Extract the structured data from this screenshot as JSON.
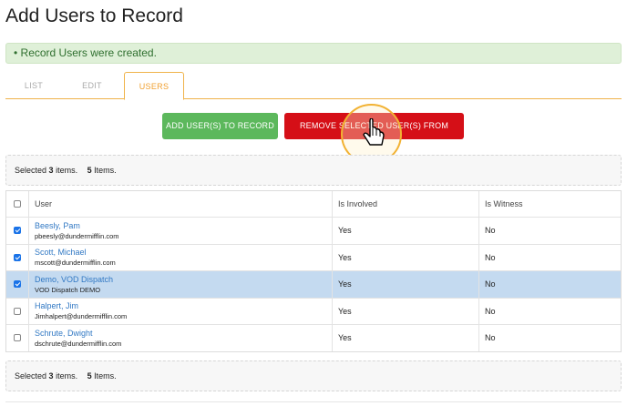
{
  "page": {
    "title": "Add Users to Record"
  },
  "alert": {
    "text": "• Record Users were created."
  },
  "tabs": [
    {
      "label": "LIST",
      "active": false
    },
    {
      "label": "EDIT",
      "active": false
    },
    {
      "label": "USERS",
      "active": true
    }
  ],
  "actions": {
    "add_label": "ADD USER(S) TO RECORD",
    "remove_label": "REMOVE SELECTED USER(S) FROM RECORD"
  },
  "summary": {
    "prefix": "Selected",
    "selected_count": "3",
    "selected_suffix": "items.",
    "total_count": "5",
    "total_suffix": "Items."
  },
  "table": {
    "columns": [
      "User",
      "Is Involved",
      "Is Witness"
    ],
    "rows": [
      {
        "name": "Beesly, Pam",
        "email": "pbeesly@dundermifflin.com",
        "involved": "Yes",
        "witness": "No",
        "checked": true,
        "highlighted": false
      },
      {
        "name": "Scott, Michael",
        "email": "mscott@dundermifflin.com",
        "involved": "Yes",
        "witness": "No",
        "checked": true,
        "highlighted": false
      },
      {
        "name": "Demo, VOD Dispatch",
        "email": "VOD Dispatch DEMO",
        "involved": "Yes",
        "witness": "No",
        "checked": true,
        "highlighted": true
      },
      {
        "name": "Halpert, Jim",
        "email": "Jimhalpert@dundermifflin.com",
        "involved": "Yes",
        "witness": "No",
        "checked": false,
        "highlighted": false
      },
      {
        "name": "Schrute, Dwight",
        "email": "dschrute@dundermifflin.com",
        "involved": "Yes",
        "witness": "No",
        "checked": false,
        "highlighted": false
      }
    ]
  },
  "colors": {
    "accent": "#f0a030",
    "add_button": "#5cb85c",
    "remove_button": "#d50f17",
    "link": "#3279c4",
    "row_highlight": "#c4daf0",
    "alert_bg": "#dff0d8"
  },
  "icons": {
    "cursor": "pointer-hand-icon",
    "checkbox": "checkbox-icon"
  }
}
